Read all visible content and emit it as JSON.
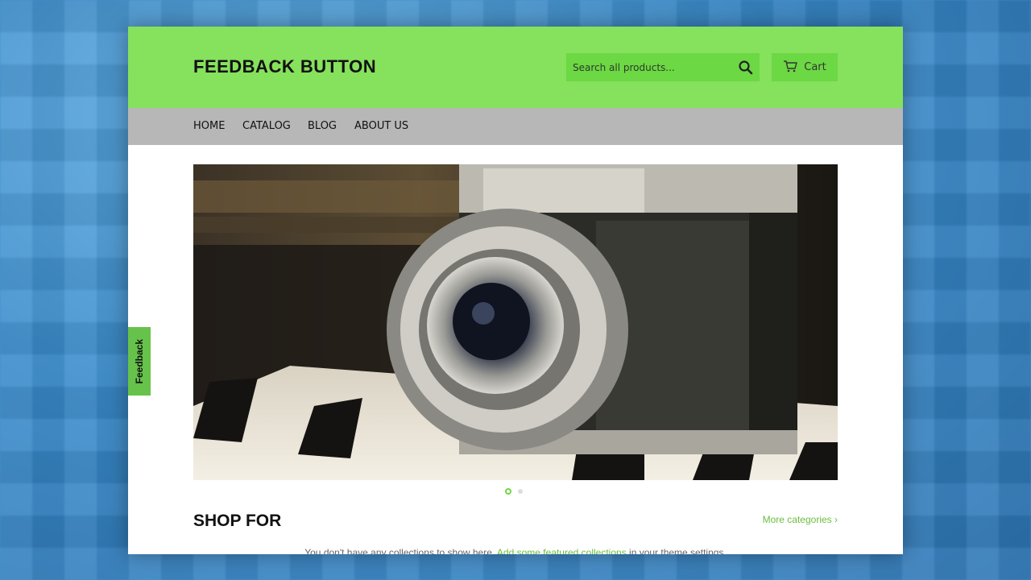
{
  "brand": {
    "title": "FEEDBACK BUTTON"
  },
  "search": {
    "placeholder": "Search all products...",
    "icon": "search-icon"
  },
  "cart": {
    "label": "Cart",
    "icon": "cart-icon"
  },
  "nav": {
    "items": [
      {
        "label": "HOME"
      },
      {
        "label": "CATALOG"
      },
      {
        "label": "BLOG"
      },
      {
        "label": "ABOUT US"
      }
    ]
  },
  "slider": {
    "total_slides": 2,
    "active_slide": 1
  },
  "shop_for": {
    "heading": "SHOP FOR",
    "more_link": "More categories ›",
    "empty_prefix": "You don't have any collections to show here. ",
    "empty_link": "Add some featured collections",
    "empty_suffix": " in your theme settings."
  },
  "feedback_tab": {
    "label": "Feedback"
  },
  "colors": {
    "header_green": "#86e15d",
    "field_green": "#6cd844",
    "nav_gray": "#b7b7b7",
    "link_green": "#6bbd3f",
    "feedback_green": "#66c24a"
  }
}
